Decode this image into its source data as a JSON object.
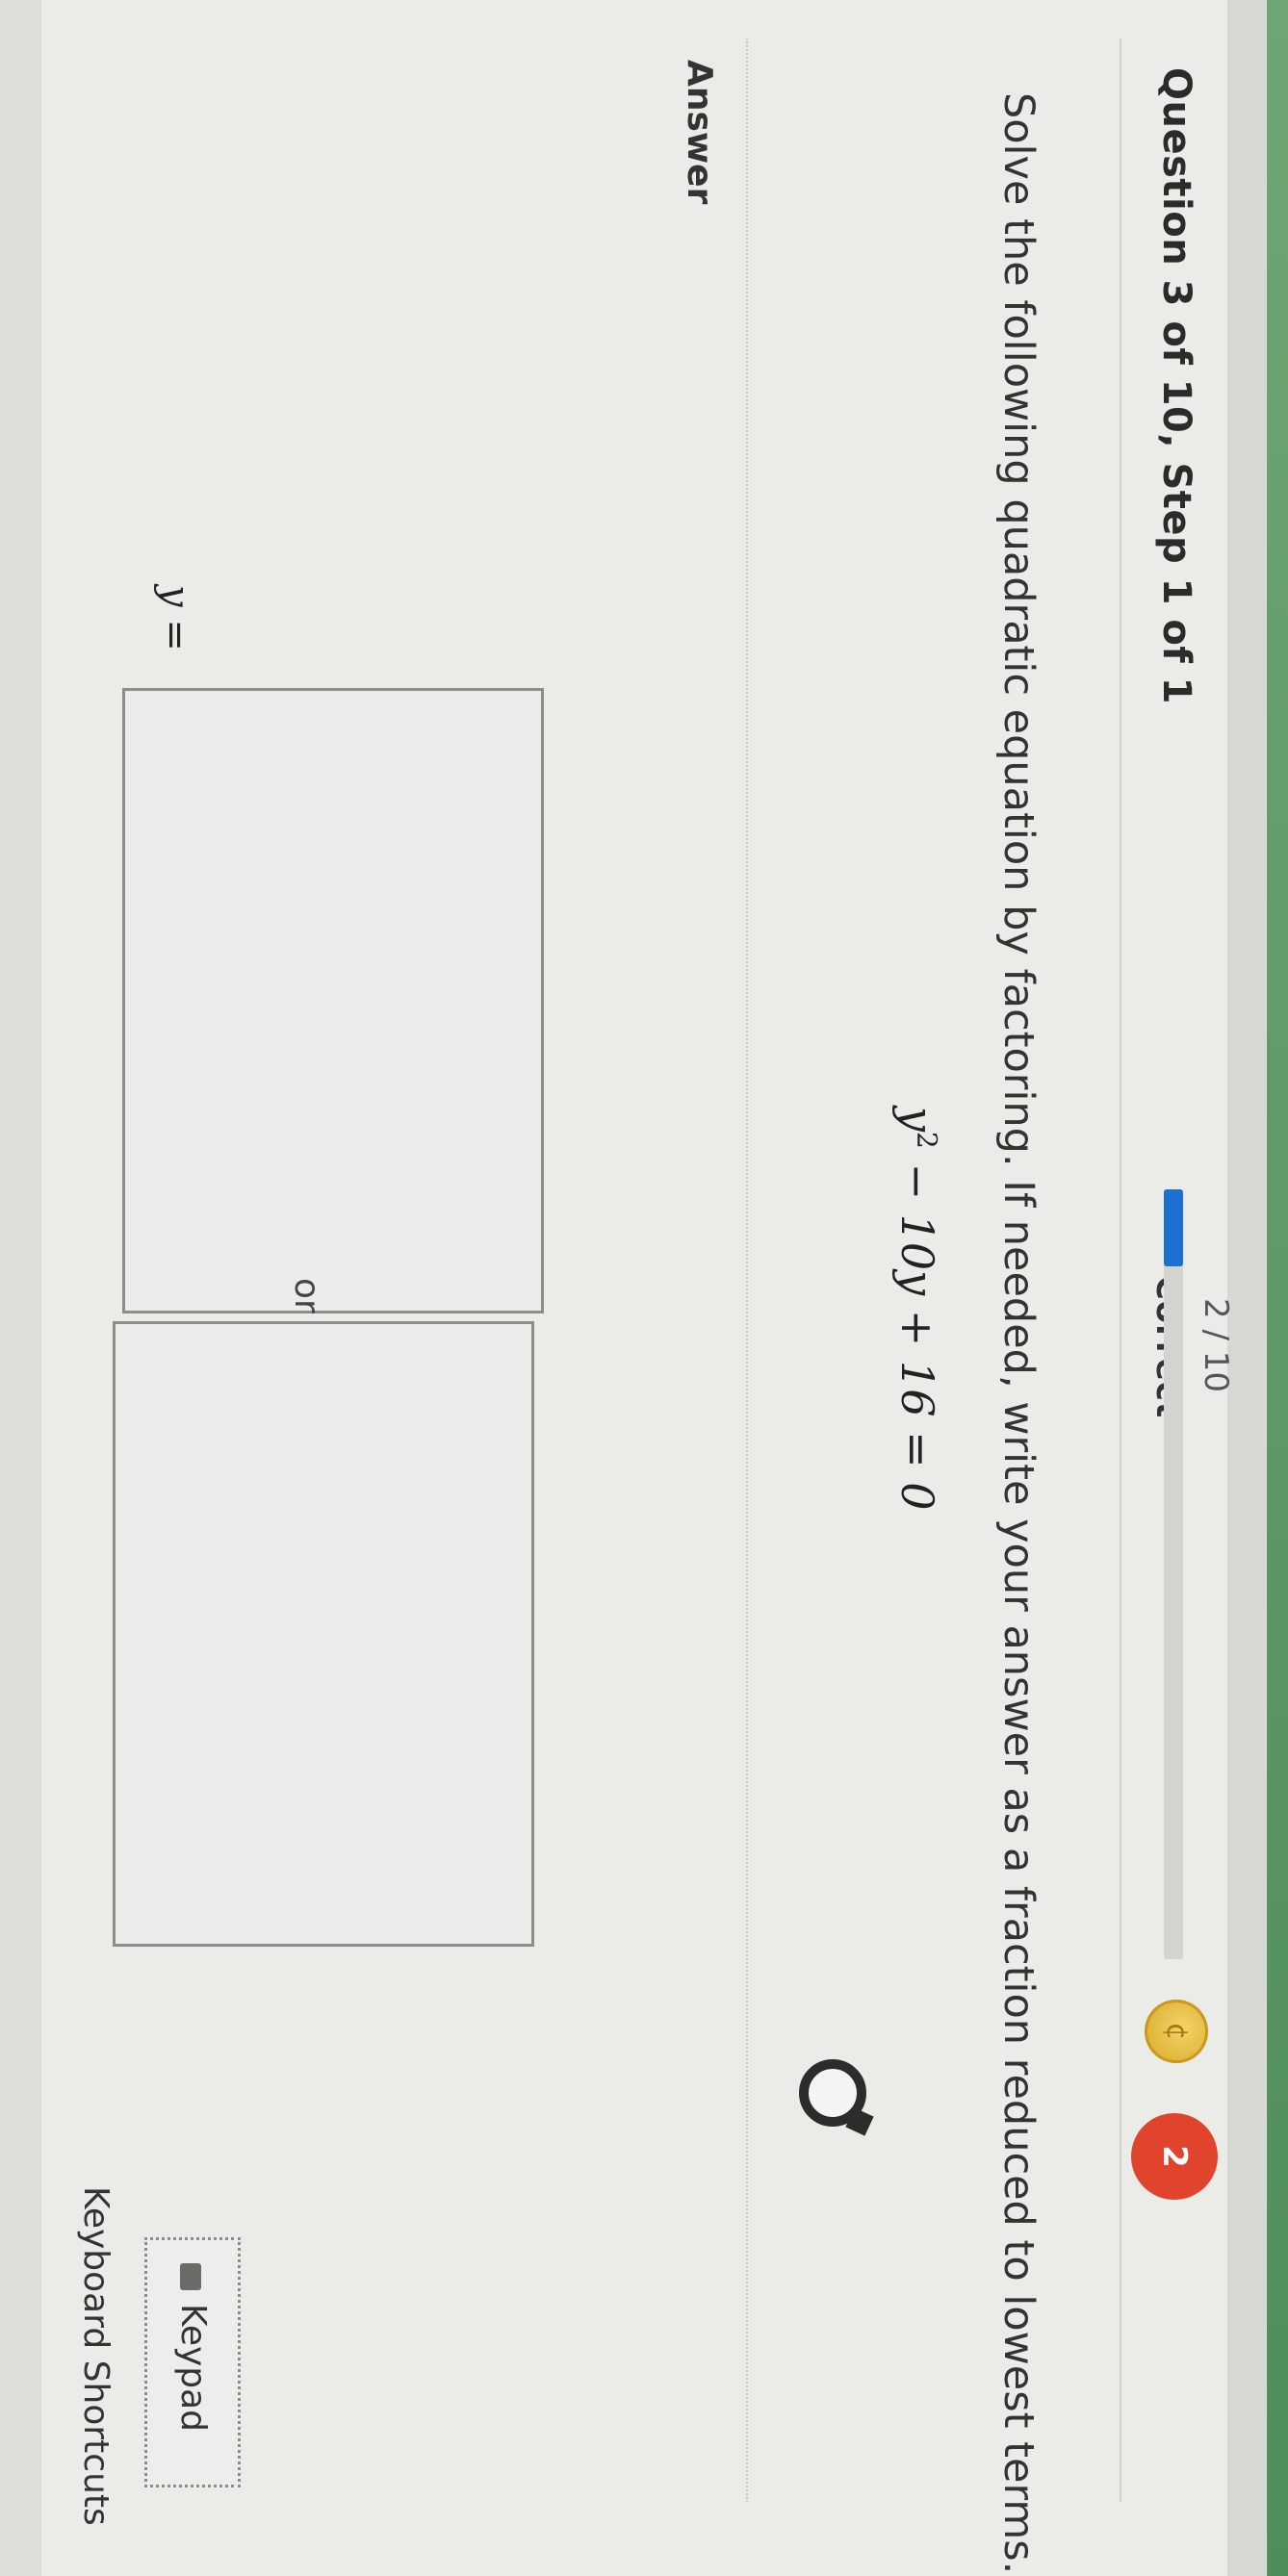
{
  "header": {
    "question_title": "Question 3 of 10, Step 1 of 1",
    "score": "2 / 10",
    "score_status": "Correct",
    "progress_fraction": 0.1,
    "progress_color": "#1d6fd2",
    "coin_icon": "coin-icon",
    "heart_count": "2",
    "heart_color": "#e0442c"
  },
  "question": {
    "instruction": "Solve the following quadratic equation by factoring. If needed, write your answer as a fraction reduced to lowest terms.",
    "equation_lhs": "y",
    "equation_exp": "2",
    "equation_rest": " − 10y + 16 = 0",
    "hint_icon": "hint-icon"
  },
  "answer": {
    "label": "Answer",
    "variable_label": "y =",
    "box1_value": "",
    "or_label": "or",
    "box2_value": "",
    "keypad_label": "Keypad",
    "keypad_icon": "keyboard-icon",
    "shortcuts_label": "Keyboard Shortcuts"
  }
}
